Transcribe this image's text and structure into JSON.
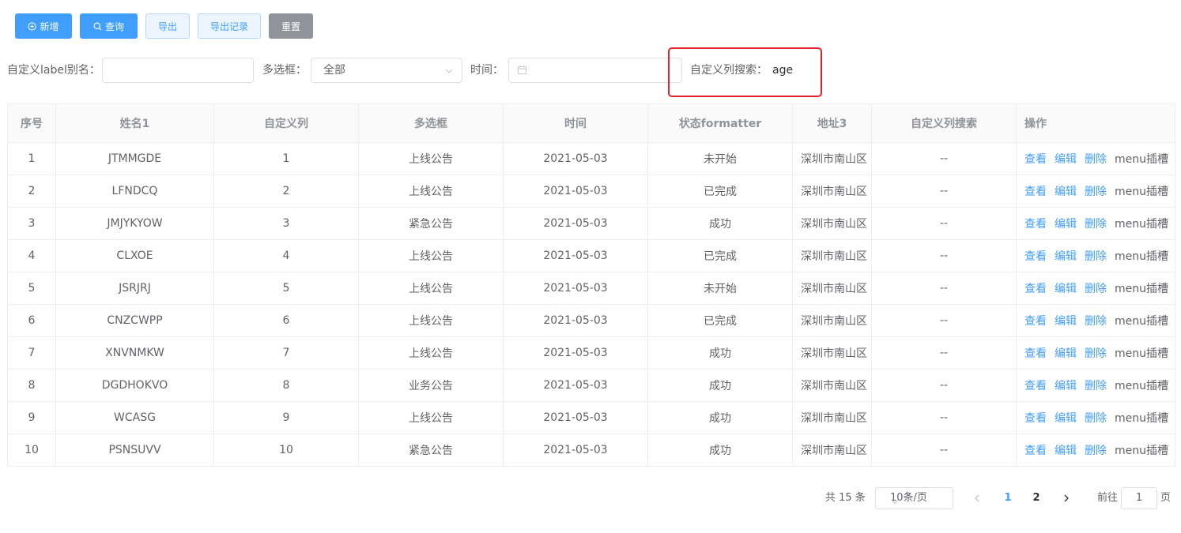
{
  "toolbar": {
    "add_label": "新增",
    "query_label": "查询",
    "export_label": "导出",
    "export_records_label": "导出记录",
    "reset_label": "重置"
  },
  "search": {
    "alias_label": "自定义label别名：",
    "alias_value": "",
    "select_label": "多选框：",
    "select_value": "全部",
    "time_label": "时间：",
    "time_value": "",
    "custom_label": "自定义列搜索：",
    "custom_value": "age"
  },
  "table": {
    "headers": [
      "序号",
      "姓名1",
      "自定义列",
      "多选框",
      "时间",
      "状态formatter",
      "地址3",
      "自定义列搜索",
      "操作"
    ],
    "rows": [
      [
        "1",
        "JTMMGDE",
        "1",
        "上线公告",
        "2021-05-03",
        "未开始",
        "深圳市南山区",
        "--"
      ],
      [
        "2",
        "LFNDCQ",
        "2",
        "上线公告",
        "2021-05-03",
        "已完成",
        "深圳市南山区",
        "--"
      ],
      [
        "3",
        "JMJYKYOW",
        "3",
        "紧急公告",
        "2021-05-03",
        "成功",
        "深圳市南山区",
        "--"
      ],
      [
        "4",
        "CLXOE",
        "4",
        "上线公告",
        "2021-05-03",
        "已完成",
        "深圳市南山区",
        "--"
      ],
      [
        "5",
        "JSRJRJ",
        "5",
        "上线公告",
        "2021-05-03",
        "未开始",
        "深圳市南山区",
        "--"
      ],
      [
        "6",
        "CNZCWPP",
        "6",
        "上线公告",
        "2021-05-03",
        "已完成",
        "深圳市南山区",
        "--"
      ],
      [
        "7",
        "XNVNMKW",
        "7",
        "上线公告",
        "2021-05-03",
        "成功",
        "深圳市南山区",
        "--"
      ],
      [
        "8",
        "DGDHOKVO",
        "8",
        "业务公告",
        "2021-05-03",
        "成功",
        "深圳市南山区",
        "--"
      ],
      [
        "9",
        "WCASG",
        "9",
        "上线公告",
        "2021-05-03",
        "成功",
        "深圳市南山区",
        "--"
      ],
      [
        "10",
        "PSNSUVV",
        "10",
        "紧急公告",
        "2021-05-03",
        "成功",
        "深圳市南山区",
        "--"
      ]
    ],
    "actions": {
      "view": "查看",
      "edit": "编辑",
      "delete": "删除",
      "slot": "menu插槽"
    }
  },
  "pagination": {
    "total": "共 15 条",
    "page_size": "10条/页",
    "pages": [
      "1",
      "2"
    ],
    "current_page": "1",
    "goto_label": "前往",
    "goto_value": "1",
    "goto_suffix": "页"
  },
  "colors": {
    "primary": "#409eff",
    "highlight": "#e5202e",
    "info": "#909399"
  }
}
